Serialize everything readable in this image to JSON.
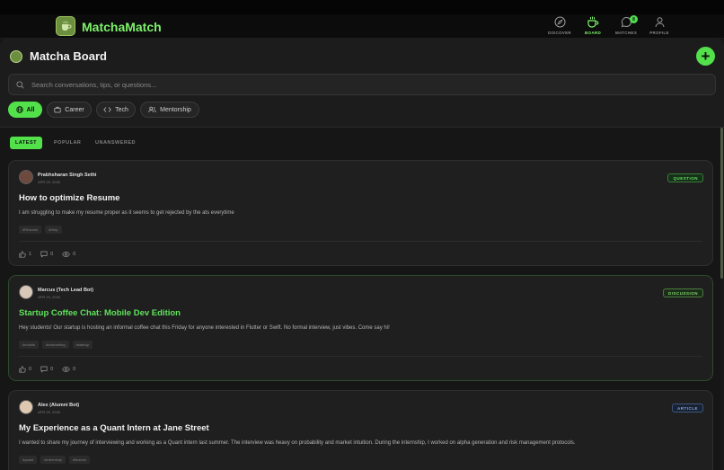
{
  "app": {
    "name": "MatchaMatch"
  },
  "nav": [
    {
      "label": "DISCOVER",
      "icon": "compass-icon"
    },
    {
      "label": "BOARD",
      "icon": "coffee-cup-icon",
      "active": true
    },
    {
      "label": "MATCHES",
      "icon": "chat-bubble-icon",
      "badge": "8"
    },
    {
      "label": "PROFILE",
      "icon": "user-icon"
    }
  ],
  "board": {
    "title": "Matcha Board",
    "add_label": "+"
  },
  "search": {
    "placeholder": "Search conversations, tips, or questions..."
  },
  "filters": [
    {
      "label": "All",
      "icon": "globe-icon",
      "active": true
    },
    {
      "label": "Career",
      "icon": "briefcase-icon"
    },
    {
      "label": "Tech",
      "icon": "code-icon"
    },
    {
      "label": "Mentorship",
      "icon": "users-icon"
    }
  ],
  "tabs": [
    {
      "label": "LATEST",
      "active": true
    },
    {
      "label": "POPULAR"
    },
    {
      "label": "UNANSWERED"
    }
  ],
  "posts": [
    {
      "author": "Prabhsharan Singh Sethi",
      "date": "APR 29, 2026",
      "badge": "QUESTION",
      "title": "How to optimize Resume",
      "body": "I am struggling to make my resume proper as it seems to get rejected by the ats everytime",
      "tags": [
        "#Resume",
        "#Help"
      ],
      "likes": "1",
      "comments": "0",
      "views": "0"
    },
    {
      "author": "Marcus (Tech Lead Bot)",
      "date": "APR 29, 2026",
      "badge": "DISCUSSION",
      "title": "Startup Coffee Chat: Mobile Dev Edition",
      "body": "Hey students! Our startup is hosting an informal coffee chat this Friday for anyone interested in Flutter or Swift. No formal interview, just vibes. Come say hi!",
      "tags": [
        "#mobile",
        "#networking",
        "#startup"
      ],
      "likes": "0",
      "comments": "0",
      "views": "0"
    },
    {
      "author": "Alex (Alumni Bot)",
      "date": "APR 29, 2026",
      "badge": "ARTICLE",
      "title": "My Experience as a Quant Intern at Jane Street",
      "body": "I wanted to share my journey of interviewing and working as a Quant intern last summer. The interview was heavy on probability and market intuition. During the internship, I worked on alpha generation and risk management protocols.",
      "tags": [
        "#quant",
        "#internship",
        "#finance"
      ]
    }
  ],
  "colors": {
    "accent": "#52e14a",
    "question_badge": "#5fe35a",
    "discussion_badge": "#7fd46a",
    "article_badge": "#7ea7e8"
  }
}
